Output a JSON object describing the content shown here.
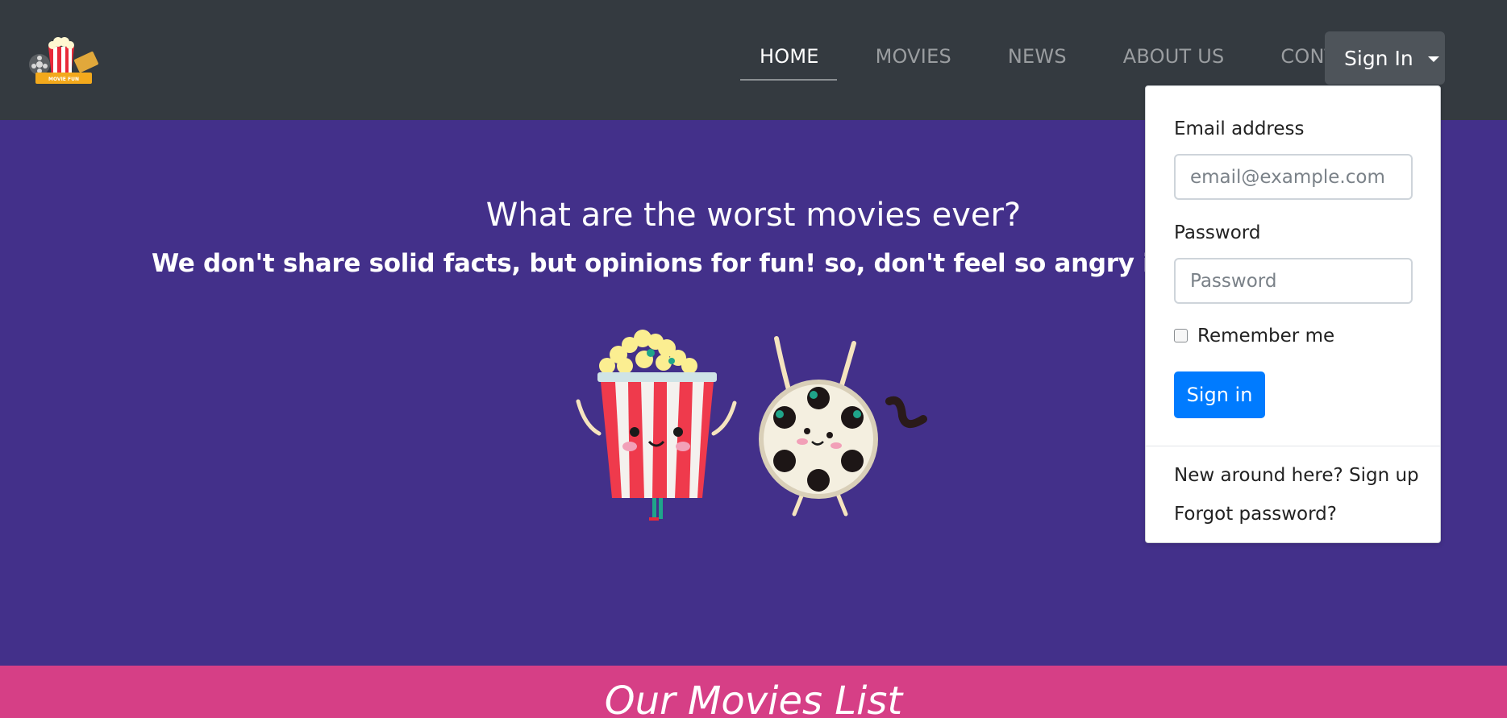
{
  "brand": {
    "logo_text": "MOVIE FUN"
  },
  "nav": {
    "links": [
      {
        "label": "HOME",
        "active": true
      },
      {
        "label": "MOVIES",
        "active": false
      },
      {
        "label": "NEWS",
        "active": false
      },
      {
        "label": "ABOUT US",
        "active": false
      },
      {
        "label": "CONTACT US",
        "active": false
      }
    ],
    "signin_label": "Sign In"
  },
  "hero": {
    "title": "What are the worst movies ever?",
    "subtitle": "We don't share solid facts, but opinions for fun! so, don't feel so angry if you found yo"
  },
  "signin_dropdown": {
    "email_label": "Email address",
    "email_placeholder": "email@example.com",
    "password_label": "Password",
    "password_placeholder": "Password",
    "remember_label": "Remember me",
    "remember_checked": false,
    "submit_label": "Sign in",
    "signup_link": "New around here? Sign up",
    "forgot_link": "Forgot password?"
  },
  "movies_section": {
    "title": "Our Movies List"
  },
  "colors": {
    "navbar_bg": "#343a40",
    "hero_bg": "#43308a",
    "movies_band_bg": "#d63f86",
    "primary_button": "#007bff"
  }
}
